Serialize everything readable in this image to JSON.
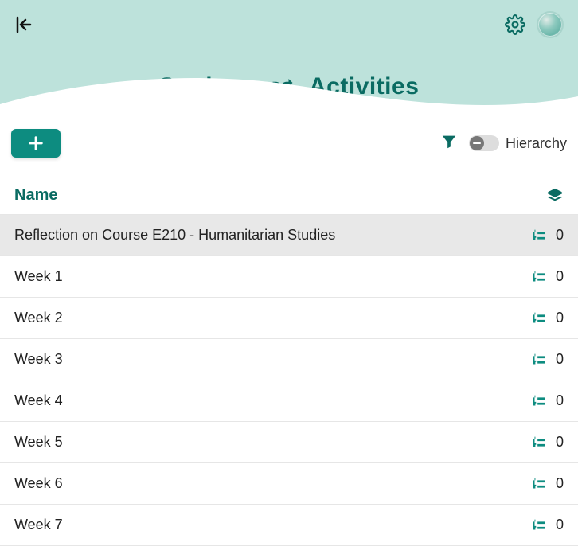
{
  "tabs": {
    "settings": "Settings",
    "activities": "Activities"
  },
  "toolbar": {
    "hierarchy_label": "Hierarchy",
    "hierarchy_on": false
  },
  "table": {
    "headers": {
      "name": "Name"
    },
    "rows": [
      {
        "name": "Reflection on Course E210 - Humanitarian Studies",
        "count": "0",
        "highlight": true
      },
      {
        "name": "Week 1",
        "count": "0",
        "highlight": false
      },
      {
        "name": "Week 2",
        "count": "0",
        "highlight": false
      },
      {
        "name": "Week 3",
        "count": "0",
        "highlight": false
      },
      {
        "name": "Week 4",
        "count": "0",
        "highlight": false
      },
      {
        "name": "Week 5",
        "count": "0",
        "highlight": false
      },
      {
        "name": "Week 6",
        "count": "0",
        "highlight": false
      },
      {
        "name": "Week 7",
        "count": "0",
        "highlight": false
      }
    ]
  }
}
